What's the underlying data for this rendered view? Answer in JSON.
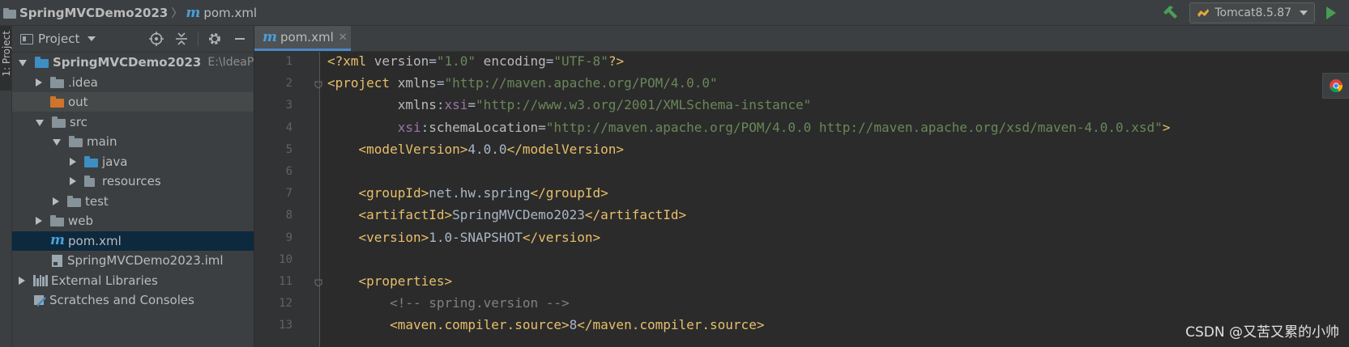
{
  "navbar": {
    "project_name": "SpringMVCDemo2023",
    "file_name": "pom.xml",
    "run_config": "Tomcat8.5.87"
  },
  "left_strip": {
    "label": "1: Project"
  },
  "project_panel": {
    "title": "Project",
    "tree": [
      {
        "label": "SpringMVCDemo2023",
        "hint": "E:\\IdeaProjec",
        "level": 0,
        "arrow": "down",
        "icon": "module-folder-icon",
        "bold": true
      },
      {
        "label": ".idea",
        "level": 1,
        "arrow": "right",
        "icon": "folder-icon"
      },
      {
        "label": "out",
        "level": 1,
        "arrow": "none",
        "icon": "excluded-folder-icon"
      },
      {
        "label": "src",
        "level": 1,
        "arrow": "down",
        "icon": "folder-icon"
      },
      {
        "label": "main",
        "level": 2,
        "arrow": "down",
        "icon": "folder-icon"
      },
      {
        "label": "java",
        "level": 3,
        "arrow": "right",
        "icon": "source-folder-icon"
      },
      {
        "label": "resources",
        "level": 3,
        "arrow": "right",
        "icon": "resources-folder-icon"
      },
      {
        "label": "test",
        "level": 2,
        "arrow": "right",
        "icon": "folder-icon"
      },
      {
        "label": "web",
        "level": 1,
        "arrow": "right",
        "icon": "web-folder-icon"
      },
      {
        "label": "pom.xml",
        "level": 1,
        "arrow": "none",
        "icon": "maven-icon",
        "selected": true
      },
      {
        "label": "SpringMVCDemo2023.iml",
        "level": 1,
        "arrow": "none",
        "icon": "iml-file-icon"
      },
      {
        "label": "External Libraries",
        "level": 0,
        "arrow": "right",
        "icon": "libraries-icon"
      },
      {
        "label": "Scratches and Consoles",
        "level": 0,
        "arrow": "none",
        "icon": "scratches-icon"
      }
    ]
  },
  "editor": {
    "tab_label": "pom.xml",
    "line_numbers": [
      "1",
      "2",
      "3",
      "4",
      "5",
      "6",
      "7",
      "8",
      "9",
      "10",
      "11",
      "12",
      "13"
    ],
    "lines": [
      [
        [
          "tag",
          "<?xml "
        ],
        [
          "attr",
          "version"
        ],
        [
          "text",
          "="
        ],
        [
          "str",
          "\"1.0\""
        ],
        [
          "attr",
          " encoding"
        ],
        [
          "text",
          "="
        ],
        [
          "str",
          "\"UTF-8\""
        ],
        [
          "tag",
          "?>"
        ]
      ],
      [
        [
          "tag",
          "<project "
        ],
        [
          "attr",
          "xmlns"
        ],
        [
          "text",
          "="
        ],
        [
          "str",
          "\"http://maven.apache.org/POM/4.0.0\""
        ]
      ],
      [
        [
          "attr",
          "         xmlns"
        ],
        [
          "text",
          ":"
        ],
        [
          "ns",
          "xsi"
        ],
        [
          "text",
          "="
        ],
        [
          "str",
          "\"http://www.w3.org/2001/XMLSchema-instance\""
        ]
      ],
      [
        [
          "ns",
          "         xsi"
        ],
        [
          "text",
          ":"
        ],
        [
          "attr",
          "schemaLocation"
        ],
        [
          "text",
          "="
        ],
        [
          "str",
          "\"http://maven.apache.org/POM/4.0.0 http://maven.apache.org/xsd/maven-4.0.0.xsd\""
        ],
        [
          "tag",
          ">"
        ]
      ],
      [
        [
          "tag",
          "    <modelVersion>"
        ],
        [
          "text",
          "4.0.0"
        ],
        [
          "tag",
          "</modelVersion>"
        ]
      ],
      [],
      [
        [
          "tag",
          "    <groupId>"
        ],
        [
          "text",
          "net.hw.spring"
        ],
        [
          "tag",
          "</groupId>"
        ]
      ],
      [
        [
          "tag",
          "    <artifactId>"
        ],
        [
          "text",
          "SpringMVCDemo2023"
        ],
        [
          "tag",
          "</artifactId>"
        ]
      ],
      [
        [
          "tag",
          "    <version>"
        ],
        [
          "text",
          "1.0-SNAPSHOT"
        ],
        [
          "tag",
          "</version>"
        ]
      ],
      [],
      [
        [
          "tag",
          "    <properties>"
        ]
      ],
      [
        [
          "comment",
          "        <!-- spring.version -->"
        ]
      ],
      [
        [
          "tag",
          "        <maven.compiler.source>"
        ],
        [
          "text",
          "8"
        ],
        [
          "tag",
          "</maven.compiler.source>"
        ]
      ]
    ]
  },
  "watermark": "CSDN @又苦又累的小帅",
  "colors": {
    "tag": "#e8bf6a",
    "attr": "#bababa",
    "ns": "#9876aa",
    "str": "#6a8759",
    "text": "#a9b7c6",
    "comment": "#808080"
  }
}
